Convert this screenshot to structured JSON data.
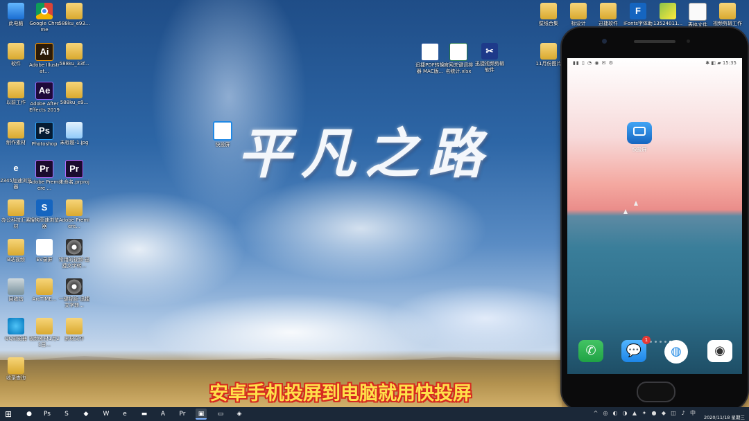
{
  "desktop_icons": [
    {
      "label": "此电脑",
      "glyph": "",
      "cls": "g-pc",
      "icon": "computer-icon"
    },
    {
      "label": "Google Chrome",
      "glyph": "",
      "cls": "g-chrome",
      "icon": "chrome-icon"
    },
    {
      "label": "588ku_e93...",
      "glyph": "",
      "cls": "g-folder",
      "icon": "folder-icon"
    },
    {
      "label": "软件",
      "glyph": "",
      "cls": "g-folder",
      "icon": "folder-icon"
    },
    {
      "label": "Adobe Illustrat...",
      "glyph": "Ai",
      "cls": "g-ai",
      "icon": "illustrator-icon"
    },
    {
      "label": "588ku_33f...",
      "glyph": "",
      "cls": "g-folder",
      "icon": "folder-icon"
    },
    {
      "label": "以前工作",
      "glyph": "",
      "cls": "g-folder",
      "icon": "folder-icon"
    },
    {
      "label": "Adobe After Effects 2019",
      "glyph": "Ae",
      "cls": "g-ae",
      "icon": "after-effects-icon"
    },
    {
      "label": "588ku_e9...",
      "glyph": "",
      "cls": "g-folder",
      "icon": "folder-icon"
    },
    {
      "label": "制作素材",
      "glyph": "",
      "cls": "g-folder",
      "icon": "folder-icon"
    },
    {
      "label": "Photoshop",
      "glyph": "Ps",
      "cls": "g-ps",
      "icon": "photoshop-icon"
    },
    {
      "label": "未标题-1.jpg",
      "glyph": "",
      "cls": "g-img",
      "icon": "image-file-icon"
    },
    {
      "label": "2345加速浏览器",
      "glyph": "e",
      "cls": "g-ie",
      "icon": "browser-icon"
    },
    {
      "label": "Adobe Premiere ...",
      "glyph": "Pr",
      "cls": "g-pr",
      "icon": "premiere-icon"
    },
    {
      "label": "未命名.prproj",
      "glyph": "Pr",
      "cls": "g-pr",
      "icon": "premiere-project-icon"
    },
    {
      "label": "办公科技汇素材",
      "glyph": "",
      "cls": "g-folder",
      "icon": "folder-icon"
    },
    {
      "label": "搜狗高速浏览器",
      "glyph": "S",
      "cls": "g-sogou",
      "icon": "sogou-browser-icon"
    },
    {
      "label": "Adobe Premiere...",
      "glyph": "",
      "cls": "g-folder",
      "icon": "folder-icon"
    },
    {
      "label": "B站视频",
      "glyph": "",
      "cls": "g-folder",
      "icon": "folder-icon"
    },
    {
      "label": "EV录屏",
      "glyph": "✿",
      "cls": "g-ev",
      "icon": "ev-recorder-icon"
    },
    {
      "label": "常用的视频-迅捷文字转...",
      "glyph": "",
      "cls": "g-disc",
      "icon": "media-file-icon"
    },
    {
      "label": "回收站",
      "glyph": "",
      "cls": "g-bin",
      "icon": "recycle-bin-icon"
    },
    {
      "label": "ArcTIME...",
      "glyph": "",
      "cls": "g-folder",
      "icon": "folder-icon"
    },
    {
      "label": "一键视频-迅捷文字转...",
      "glyph": "",
      "cls": "g-disc",
      "icon": "media-file-icon"
    },
    {
      "label": "QQ浏览器",
      "glyph": "",
      "cls": "g-qq",
      "icon": "qq-browser-icon"
    },
    {
      "label": "视频素材1月21日...",
      "glyph": "",
      "cls": "g-folder",
      "icon": "folder-icon"
    },
    {
      "label": "素材文件",
      "glyph": "",
      "cls": "g-folder",
      "icon": "folder-icon"
    },
    {
      "label": "收录查询",
      "glyph": "",
      "cls": "g-folder",
      "icon": "folder-icon"
    }
  ],
  "middle_icons": [
    {
      "label": "迅捷PDF转换器 MAC版...",
      "glyph": "W",
      "cls": "g-word",
      "icon": "word-doc-icon"
    },
    {
      "label": "官网关键词排名统计.xlsx",
      "glyph": "X",
      "cls": "g-excel",
      "icon": "excel-doc-icon"
    },
    {
      "label": "迅捷视频剪辑软件",
      "glyph": "✂",
      "cls": "g-cut",
      "icon": "video-editor-icon"
    },
    {
      "label": "快投屏",
      "glyph": "▣",
      "cls": "g-kuai",
      "icon": "kuaitouping-icon"
    }
  ],
  "right_icons": [
    {
      "label": "壁纸合集",
      "glyph": "",
      "cls": "g-folder",
      "icon": "folder-icon"
    },
    {
      "label": "标设计",
      "glyph": "",
      "cls": "g-folder",
      "icon": "folder-icon"
    },
    {
      "label": "迅捷软件",
      "glyph": "",
      "cls": "g-folder",
      "icon": "folder-icon"
    },
    {
      "label": "iFonts字体助手",
      "glyph": "F",
      "cls": "g-f",
      "icon": "ifonts-icon"
    },
    {
      "label": "13524011...",
      "glyph": "",
      "cls": "g-green",
      "icon": "image-file-icon"
    },
    {
      "label": "表格文件",
      "glyph": "",
      "cls": "g-doc",
      "icon": "document-icon"
    },
    {
      "label": "视频剪辑工作",
      "glyph": "",
      "cls": "g-folder",
      "icon": "folder-icon"
    },
    {
      "label": "11月份图片",
      "glyph": "",
      "cls": "g-folder",
      "icon": "folder-icon"
    }
  ],
  "overlay": {
    "big_title": "平凡之路",
    "subtitle": "安卓手机投屏到电脑就用快投屏"
  },
  "phone": {
    "status_time": "15:35",
    "status_left": "▮▮ ▯ ◔ ◉ ✉ ⚙",
    "status_right": "✱ ◧ ▰",
    "app_label": "快投屏",
    "badge_count": "1",
    "dock": [
      {
        "icon": "phone-call-icon",
        "glyph": "✆"
      },
      {
        "icon": "messages-icon",
        "glyph": "💬"
      },
      {
        "icon": "browser-icon",
        "glyph": "◍"
      },
      {
        "icon": "camera-icon",
        "glyph": "◉"
      }
    ]
  },
  "taskbar": {
    "items": [
      {
        "icon": "start-icon",
        "glyph": "⊞"
      },
      {
        "icon": "360-icon",
        "glyph": "●"
      },
      {
        "icon": "photoshop-icon",
        "glyph": "Ps"
      },
      {
        "icon": "sogou-icon",
        "glyph": "S"
      },
      {
        "icon": "browser-icon",
        "glyph": "◆"
      },
      {
        "icon": "word-icon",
        "glyph": "W"
      },
      {
        "icon": "edge-icon",
        "glyph": "e"
      },
      {
        "icon": "screen-recorder-icon",
        "glyph": "▬"
      },
      {
        "icon": "illustrator-icon",
        "glyph": "A"
      },
      {
        "icon": "premiere-icon",
        "glyph": "Pr"
      },
      {
        "icon": "kuaitouping-icon",
        "glyph": "▣"
      },
      {
        "icon": "file-explorer-icon",
        "glyph": "▭"
      },
      {
        "icon": "app-icon",
        "glyph": "◈"
      }
    ],
    "clock": "2020/11/18 星期三"
  }
}
